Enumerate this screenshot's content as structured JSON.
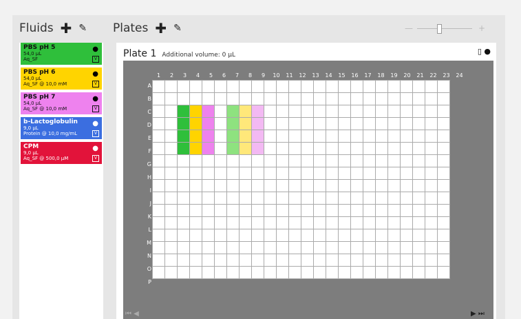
{
  "fluids": {
    "title": "Fluids",
    "items": [
      {
        "name": "PBS pH 5",
        "volume": "54,0 µL",
        "desc": "Aq_SF",
        "bg": "#2fbf3b",
        "fg": "#111",
        "drop": "black"
      },
      {
        "name": "PBS pH 6",
        "volume": "54,0 µL",
        "desc": "Aq_SF @ 10,0 mM",
        "bg": "#ffd400",
        "fg": "#111",
        "drop": "black"
      },
      {
        "name": "PBS pH 7",
        "volume": "54,0 µL",
        "desc": "Aq_SF @ 10,0 mM",
        "bg": "#ee82ee",
        "fg": "#111",
        "drop": "black"
      },
      {
        "name": "b-Lactoglobulin",
        "volume": "9,0 µL",
        "desc": "Protein @ 10,0 mg/mL",
        "bg": "#3b6ee0",
        "fg": "#fff",
        "drop": "white"
      },
      {
        "name": "CPM",
        "volume": "9,0 µL",
        "desc": "Aq_SF @ 500,0 µM",
        "bg": "#e2133a",
        "fg": "#fff",
        "drop": "white"
      }
    ]
  },
  "plates": {
    "title": "Plates",
    "plate": {
      "name": "Plate 1",
      "additional_volume": "Additional volume: 0 µL",
      "columns": [
        "1",
        "2",
        "3",
        "4",
        "5",
        "6",
        "7",
        "8",
        "9",
        "10",
        "11",
        "12",
        "13",
        "14",
        "15",
        "16",
        "17",
        "18",
        "19",
        "20",
        "21",
        "22",
        "23",
        "24"
      ],
      "rows": [
        "A",
        "B",
        "C",
        "D",
        "E",
        "F",
        "G",
        "H",
        "I",
        "J",
        "K",
        "L",
        "M",
        "N",
        "O",
        "P"
      ],
      "filled_wells": [
        {
          "rows": [
            "C",
            "D",
            "E",
            "F"
          ],
          "col": 3,
          "color": "#2fbf3b"
        },
        {
          "rows": [
            "C",
            "D",
            "E",
            "F"
          ],
          "col": 4,
          "color": "#ffd400"
        },
        {
          "rows": [
            "C",
            "D",
            "E",
            "F"
          ],
          "col": 5,
          "color": "#ee82ee"
        },
        {
          "rows": [
            "C",
            "D",
            "E",
            "F"
          ],
          "col": 7,
          "color": "#8ee27f"
        },
        {
          "rows": [
            "C",
            "D",
            "E",
            "F"
          ],
          "col": 8,
          "color": "#ffe87a"
        },
        {
          "rows": [
            "C",
            "D",
            "E",
            "F"
          ],
          "col": 9,
          "color": "#f3b9f3"
        }
      ]
    }
  }
}
